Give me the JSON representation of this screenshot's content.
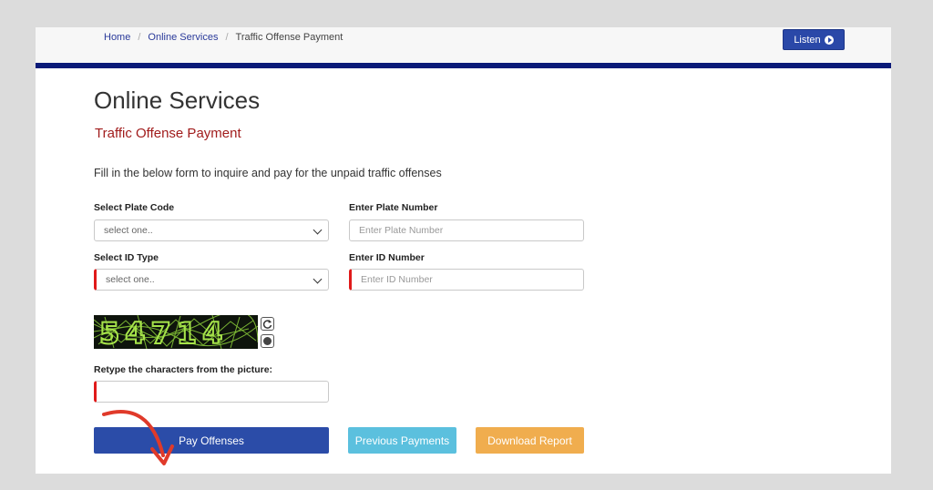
{
  "breadcrumb": {
    "home": "Home",
    "online_services": "Online Services",
    "current": "Traffic Offense Payment"
  },
  "listen_label": "Listen",
  "page_title": "Online Services",
  "sub_title": "Traffic Offense Payment",
  "intro": "Fill in the below form to inquire and pay for the unpaid traffic offenses",
  "form": {
    "plate_code_label": "Select Plate Code",
    "plate_code_value": "select one..",
    "plate_number_label": "Enter Plate Number",
    "plate_number_placeholder": "Enter Plate Number",
    "id_type_label": "Select ID Type",
    "id_type_value": "select one..",
    "id_number_label": "Enter ID Number",
    "id_number_placeholder": "Enter ID Number",
    "captcha_text": "54714",
    "captcha_label": "Retype the characters from the picture:"
  },
  "buttons": {
    "pay": "Pay Offenses",
    "previous": "Previous Payments",
    "download": "Download Report"
  },
  "colors": {
    "nav_line": "#0a1a78",
    "primary": "#2b4ca8",
    "info": "#5bc0de",
    "warning": "#f0ad4e",
    "subtitle": "#a11c1c",
    "arrow": "#e03a2a"
  },
  "icons": {
    "listen": "play-circle-icon",
    "refresh": "refresh-icon",
    "audio": "audio-icon",
    "select": "chevron-down-icon",
    "annotation": "curved-arrow-icon"
  }
}
